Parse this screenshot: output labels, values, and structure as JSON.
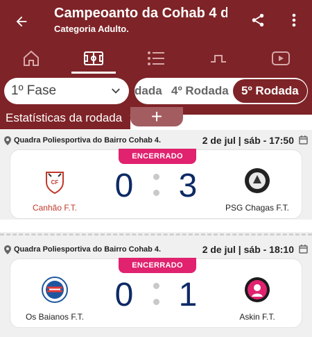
{
  "header": {
    "title": "Campeoanto da Cohab 4 d",
    "subtitle": "Categoria Adulto."
  },
  "nav_tabs": [
    {
      "icon": "home-icon",
      "active": false
    },
    {
      "icon": "field-icon",
      "active": true
    },
    {
      "icon": "list-icon",
      "active": false
    },
    {
      "icon": "bracket-icon",
      "active": false
    },
    {
      "icon": "video-icon",
      "active": false
    }
  ],
  "phase": {
    "selected": "1º Fase"
  },
  "rounds": [
    {
      "label": "dada"
    },
    {
      "label": "4º Rodada"
    },
    {
      "label": "5º Rodada",
      "active": true
    }
  ],
  "stats_tab": {
    "label": "Estatísticas da rodada",
    "plus": "+"
  },
  "matches": [
    {
      "venue": "Quadra Poliesportiva do Bairro Cohab 4.",
      "date": "2 de jul | sáb - 17:50",
      "status": "ENCERRADO",
      "home": {
        "name": "Canhão F.T.",
        "score": "0",
        "name_color": "#c0392b"
      },
      "away": {
        "name": "PSG Chagas F.T.",
        "score": "3",
        "name_color": "#222222"
      }
    },
    {
      "venue": "Quadra Poliesportiva do Bairro Cohab 4.",
      "date": "2 de jul | sáb - 18:10",
      "status": "ENCERRADO",
      "home": {
        "name": "Os Baianos F.T.",
        "score": "0",
        "name_color": "#222222"
      },
      "away": {
        "name": "Askin F.T.",
        "score": "1",
        "name_color": "#222222"
      }
    }
  ],
  "colors": {
    "brand": "#7e2327",
    "badge": "#e0226f",
    "score": "#0e2a66"
  }
}
